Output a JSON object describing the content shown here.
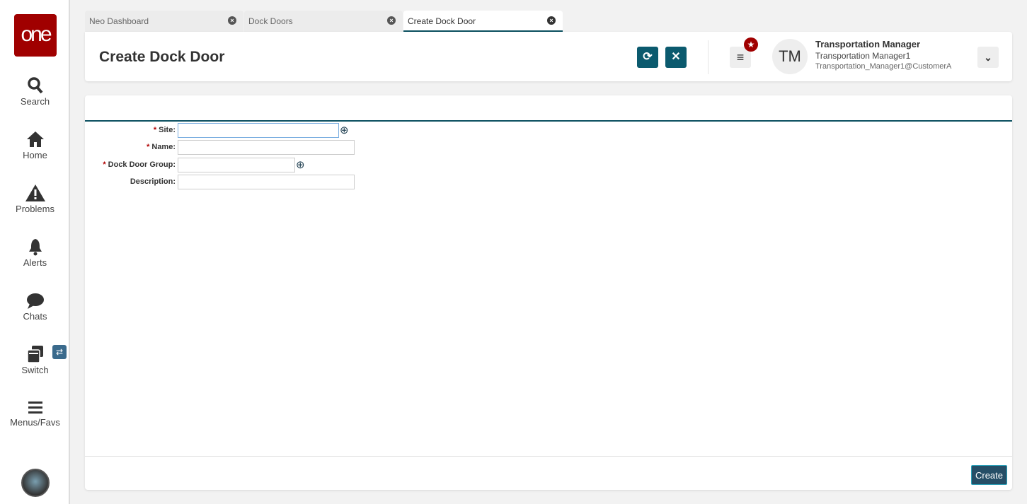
{
  "sidebar": {
    "logo": "one",
    "items": [
      {
        "label": "Search"
      },
      {
        "label": "Home"
      },
      {
        "label": "Problems"
      },
      {
        "label": "Alerts"
      },
      {
        "label": "Chats"
      },
      {
        "label": "Switch"
      },
      {
        "label": "Menus/Favs"
      }
    ]
  },
  "tabs": [
    {
      "label": "Neo Dashboard"
    },
    {
      "label": "Dock Doors"
    },
    {
      "label": "Create Dock Door"
    }
  ],
  "header": {
    "title": "Create Dock Door",
    "user": {
      "initials": "TM",
      "name": "Transportation Manager",
      "role": "Transportation Manager1",
      "email": "Transportation_Manager1@CustomerA"
    }
  },
  "form": {
    "required_mark": "*",
    "fields": [
      {
        "label": "Site:",
        "value": ""
      },
      {
        "label": "Name:",
        "value": ""
      },
      {
        "label": "Dock Door Group:",
        "value": ""
      },
      {
        "label": "Description:",
        "value": ""
      }
    ]
  },
  "footer": {
    "create_label": "Create"
  },
  "colors": {
    "brand": "#a00000",
    "accent": "#0b5a6e"
  }
}
